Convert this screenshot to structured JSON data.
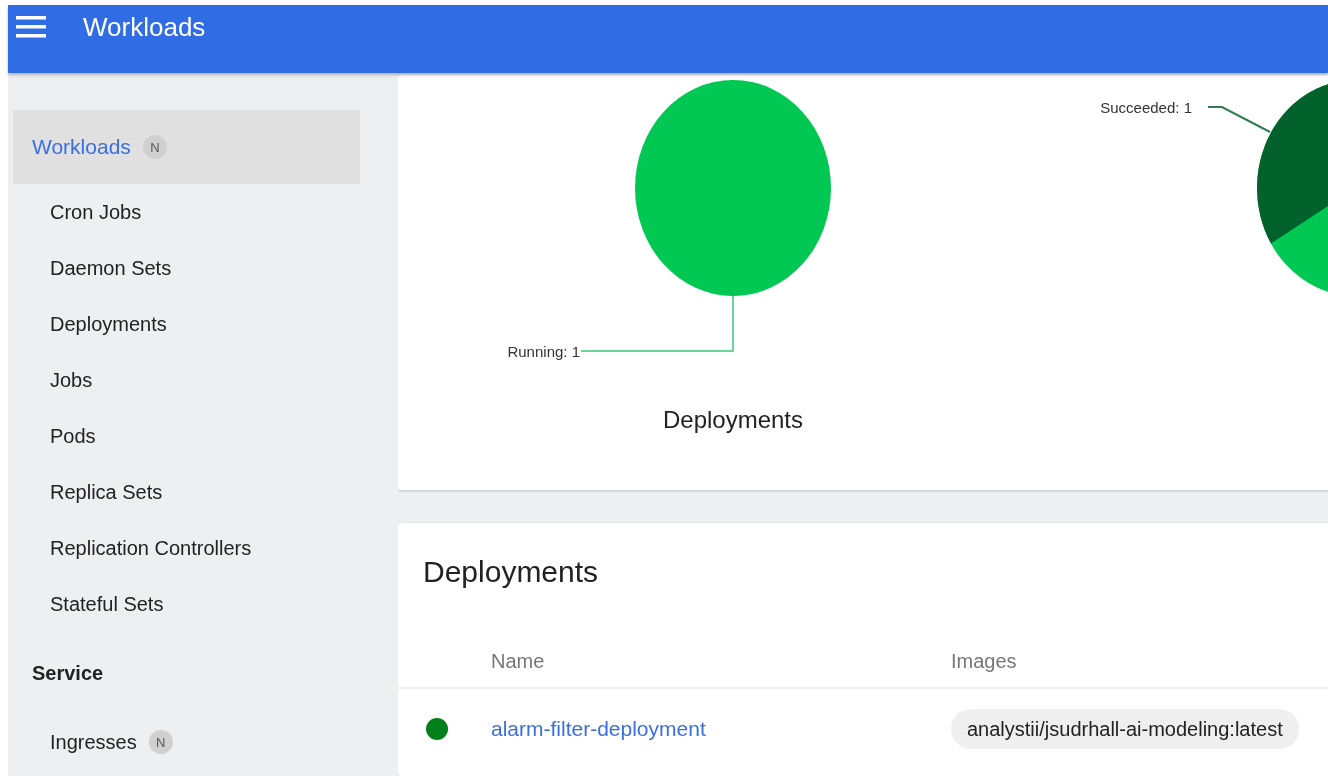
{
  "header": {
    "title": "Workloads"
  },
  "sidebar": {
    "items": [
      {
        "label": "Workloads",
        "badge": "N",
        "kind": "section",
        "selected": true
      },
      {
        "label": "Cron Jobs",
        "kind": "item",
        "selected": false
      },
      {
        "label": "Daemon Sets",
        "kind": "item",
        "selected": false
      },
      {
        "label": "Deployments",
        "kind": "item",
        "selected": false
      },
      {
        "label": "Jobs",
        "kind": "item",
        "selected": false
      },
      {
        "label": "Pods",
        "kind": "item",
        "selected": false
      },
      {
        "label": "Replica Sets",
        "kind": "item",
        "selected": false
      },
      {
        "label": "Replication Controllers",
        "kind": "item",
        "selected": false
      },
      {
        "label": "Stateful Sets",
        "kind": "item",
        "selected": false
      },
      {
        "label": "Service",
        "kind": "heading"
      },
      {
        "label": "Ingresses",
        "badge": "N",
        "kind": "item",
        "selected": false
      }
    ]
  },
  "status_charts": [
    {
      "title": "Deployments",
      "slices": [
        {
          "label": "Running: 1",
          "color": "#00c853"
        }
      ]
    },
    {
      "slices": [
        {
          "label": "Succeeded: 1",
          "color": "#03612b"
        }
      ]
    }
  ],
  "deployments": {
    "title": "Deployments",
    "columns": [
      "Name",
      "Images"
    ],
    "rows": [
      {
        "color": "#00801a",
        "name": "alarm-filter-deployment",
        "image": "analystii/jsudrhall-ai-modeling:latest"
      }
    ]
  }
}
